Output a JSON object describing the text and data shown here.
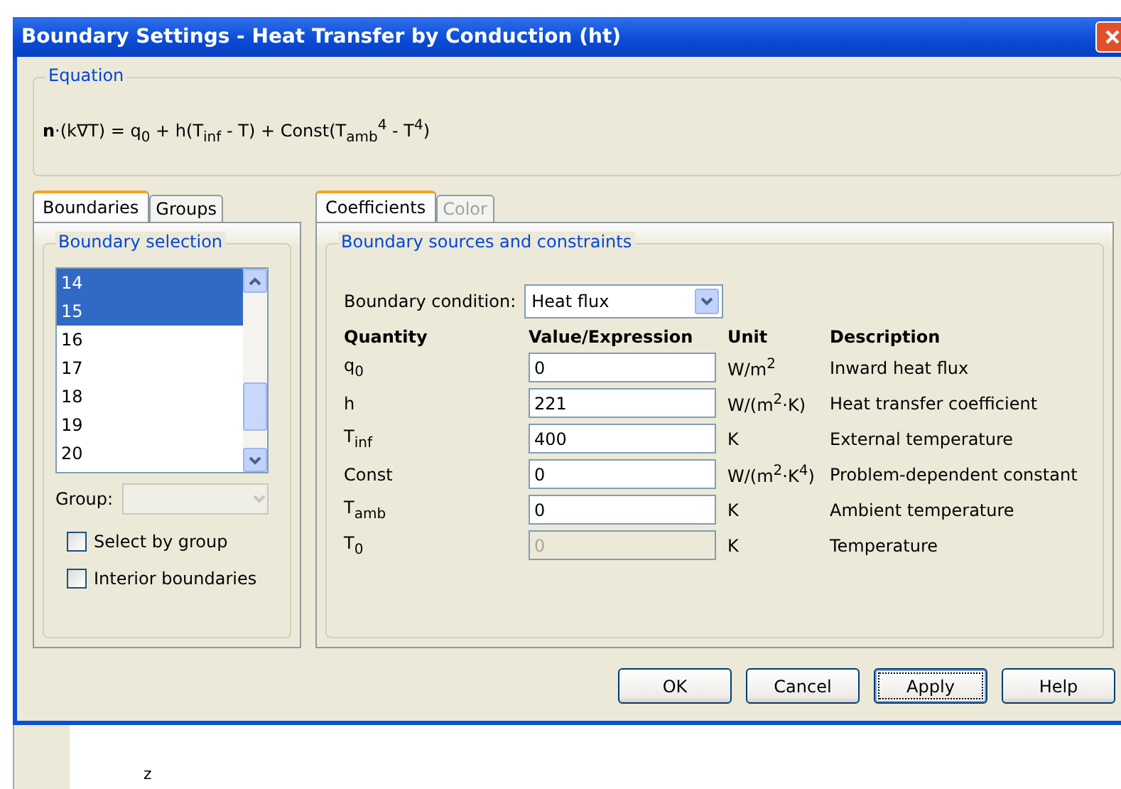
{
  "window": {
    "title": "Boundary Settings - Heat Transfer by Conduction (ht)"
  },
  "equation": {
    "title": "Equation",
    "formula": "**n**·(k∇T) = q$_{0}$ + h(T$_{inf}$ - T) + Const(T$_{amb}$$^{4}$ - T$^{4}$)"
  },
  "left_tabs": [
    {
      "label": "Boundaries",
      "selected": true
    },
    {
      "label": "Groups",
      "selected": false
    }
  ],
  "boundary_selection": {
    "title": "Boundary selection",
    "items": [
      {
        "label": "14",
        "selected": true
      },
      {
        "label": "15",
        "selected": true
      },
      {
        "label": "16",
        "selected": false
      },
      {
        "label": "17",
        "selected": false
      },
      {
        "label": "18",
        "selected": false
      },
      {
        "label": "19",
        "selected": false
      },
      {
        "label": "20",
        "selected": false
      }
    ],
    "group_label": "Group:",
    "group_disabled": true,
    "checkboxes": [
      {
        "label": "Select by group",
        "checked": false
      },
      {
        "label": "Interior boundaries",
        "checked": false
      }
    ]
  },
  "right_tabs": [
    {
      "label": "Coefficients",
      "selected": true,
      "disabled": false
    },
    {
      "label": "Color",
      "selected": false,
      "disabled": true
    }
  ],
  "sources": {
    "title": "Boundary sources and constraints",
    "condition_label": "Boundary condition:",
    "condition_value": "Heat flux",
    "columns": [
      "Quantity",
      "Value/Expression",
      "Unit",
      "Description"
    ],
    "rows": [
      {
        "quantity": "q$_{0}$",
        "value": "0",
        "unit": "W/m$^{2}$",
        "description": "Inward heat flux",
        "disabled": false
      },
      {
        "quantity": "h",
        "value": "221",
        "unit": "W/(m$^{2}$·K)",
        "description": "Heat transfer coefficient",
        "disabled": false
      },
      {
        "quantity": "T$_{inf}$",
        "value": "400",
        "unit": "K",
        "description": "External temperature",
        "disabled": false
      },
      {
        "quantity": "Const",
        "value": "0",
        "unit": "W/(m$^{2}$·K$^{4}$)",
        "description": "Problem-dependent constant",
        "disabled": false
      },
      {
        "quantity": "T$_{amb}$",
        "value": "0",
        "unit": "K",
        "description": "Ambient temperature",
        "disabled": false
      },
      {
        "quantity": "T$_{0}$",
        "value": "0",
        "unit": "K",
        "description": "Temperature",
        "disabled": true
      }
    ]
  },
  "buttons": [
    {
      "label": "OK",
      "focused": false
    },
    {
      "label": "Cancel",
      "focused": false
    },
    {
      "label": "Apply",
      "focused": true
    },
    {
      "label": "Help",
      "focused": false
    }
  ],
  "background": {
    "axis_label": "z"
  }
}
